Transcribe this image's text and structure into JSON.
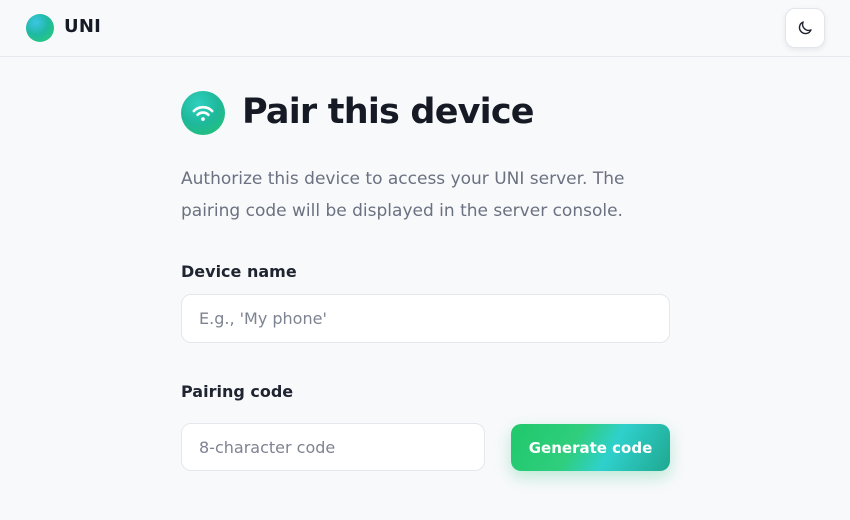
{
  "header": {
    "brand": "UNI",
    "theme_toggle_icon": "moon-icon"
  },
  "main": {
    "icon": "wifi-icon",
    "title": "Pair this device",
    "description": "Authorize this device to access your UNI server. The pairing code will be displayed in the server console.",
    "device_name": {
      "label": "Device name",
      "placeholder": "E.g., 'My phone'",
      "value": ""
    },
    "pairing_code": {
      "label": "Pairing code",
      "placeholder": "8-character code",
      "value": ""
    },
    "generate_button": "Generate code"
  },
  "colors": {
    "accent_green": "#20c86b",
    "accent_teal": "#2fd0cc",
    "background": "#f8f9fb"
  }
}
